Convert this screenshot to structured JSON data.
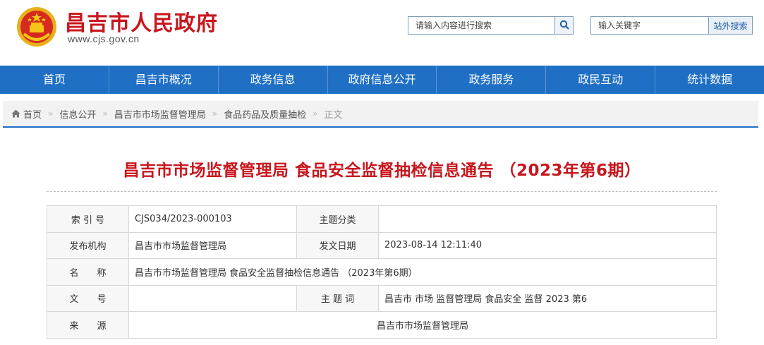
{
  "header": {
    "site_title": "昌吉市人民政府",
    "site_url": "www.cjs.gov.cn",
    "search_placeholder": "请输入内容进行搜索",
    "keyword_placeholder": "输入关键字",
    "external_search_label": "站外搜索"
  },
  "nav": {
    "items": [
      "首页",
      "昌吉市概况",
      "政务信息",
      "政府信息公开",
      "政务服务",
      "政民互动",
      "统计数据"
    ]
  },
  "breadcrumb": {
    "items": [
      "首页",
      "信息公开",
      "昌吉市市场监督管理局",
      "食品药品及质量抽检",
      "正文"
    ]
  },
  "article": {
    "title": "昌吉市市场监督管理局 食品安全监督抽检信息通告 （2023年第6期）"
  },
  "meta": {
    "index_label": "索 引 号",
    "index_value": "CJS034/2023-000103",
    "category_label": "主题分类",
    "category_value": "",
    "publisher_label": "发布机构",
    "publisher_value": "昌吉市市场监督管理局",
    "date_label": "发文日期",
    "date_value": "2023-08-14 12:11:40",
    "name_label": "名　　称",
    "name_value": "昌吉市市场监督管理局 食品安全监督抽检信息通告 （2023年第6期）",
    "docno_label": "文　　号",
    "docno_value": "",
    "keywords_label": "主 题 词",
    "keywords_value": "昌吉市 市场 监督管理局 食品安全 监督 2023 第6",
    "source_label": "来　　源",
    "source_value": "昌吉市市场监督管理局"
  },
  "colors": {
    "brand_red": "#c8161d",
    "nav_blue": "#1f6fc5"
  },
  "icons": {
    "emblem": "national-emblem-icon",
    "search": "search-icon",
    "home": "home-icon"
  }
}
